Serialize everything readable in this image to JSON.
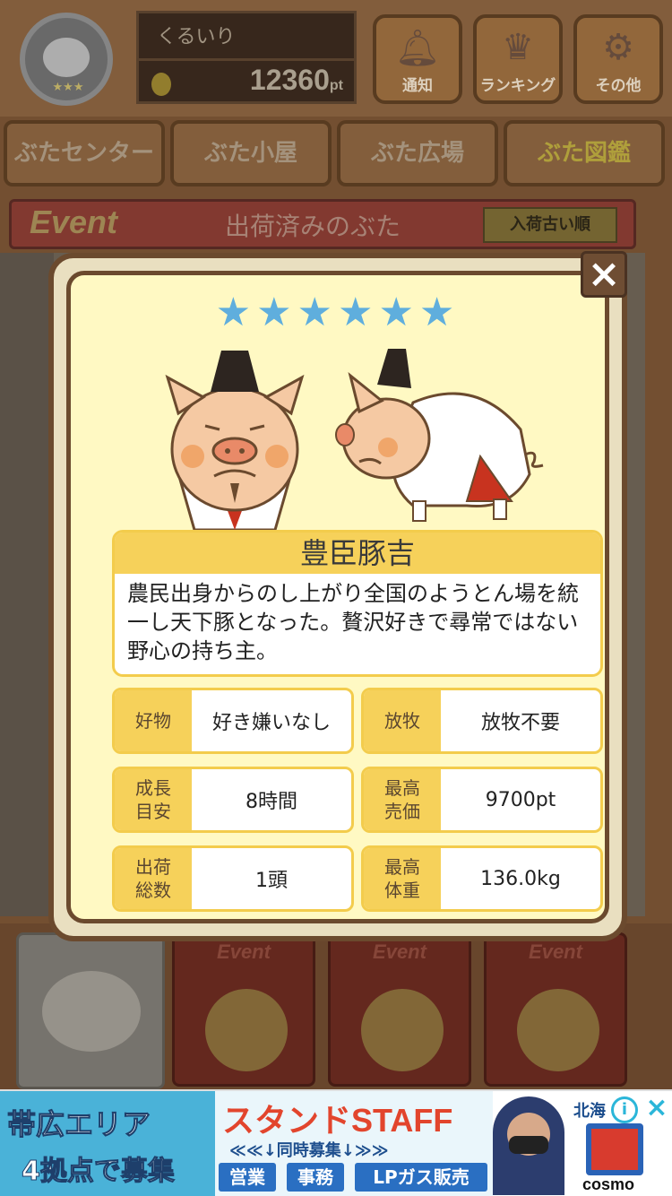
{
  "header": {
    "username": "くるいり",
    "points": "12360",
    "points_unit": "pt",
    "buttons": [
      {
        "label": "通知",
        "icon": "bell-icon"
      },
      {
        "label": "ランキング",
        "icon": "crown-icon"
      },
      {
        "label": "その他",
        "icon": "gear-icon"
      }
    ]
  },
  "nav": [
    "ぶたセンター",
    "ぶた小屋",
    "ぶた広場",
    "ぶた図鑑"
  ],
  "event_bar": {
    "logo": "Event",
    "title": "出荷済みのぶた",
    "sort_label": "入荷古い順"
  },
  "bottom_tabs": [
    "Event",
    "Event",
    "Event"
  ],
  "dialog": {
    "rarity": "★★★★★★",
    "rarity_count": 6,
    "name": "豊臣豚吉",
    "description": "農民出身からのし上がり全国のようとん場を統一し天下豚となった。贅沢好きで尋常ではない野心の持ち主。",
    "stats": [
      {
        "label": "好物",
        "value": "好き嫌いなし"
      },
      {
        "label": "放牧",
        "value": "放牧不要"
      },
      {
        "label": "成長\n目安",
        "value": "8時間"
      },
      {
        "label": "最高\n売価",
        "value": "9700pt"
      },
      {
        "label": "出荷\n総数",
        "value": "1頭"
      },
      {
        "label": "最高\n体重",
        "value": "136.0kg"
      }
    ],
    "close_label": "×"
  },
  "ad": {
    "left_line1": "帯広エリア",
    "left_line2": "4拠点で募集",
    "headline": "スタンドSTAFF",
    "sub": "≪≪↓同時募集↓≫≫",
    "chips": [
      "営業",
      "事務",
      "LPガス販売"
    ],
    "brand": "北海",
    "logo_text": "cosmo",
    "info": "i",
    "close": "×"
  },
  "colors": {
    "dialog_bg": "#fff9c3",
    "frame_brown": "#6b4a2e",
    "label_yellow": "#f6d15a",
    "star_blue": "#5faedd"
  }
}
